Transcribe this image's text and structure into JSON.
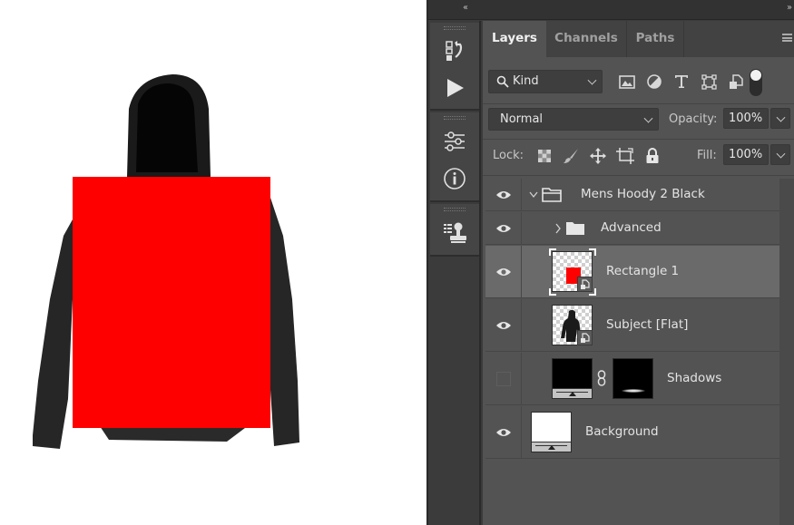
{
  "canvas": {
    "background_color": "#ffffff",
    "rectangle_color": "#ff0000",
    "garment_color": "#1e1e1e"
  },
  "window": {
    "collapse_left_glyph": "‹‹",
    "collapse_right_glyph": "››"
  },
  "dock": {
    "tools": [
      {
        "name": "history-icon"
      },
      {
        "name": "actions-play-icon"
      },
      {
        "name": "adjustments-icon"
      },
      {
        "name": "info-icon"
      },
      {
        "name": "clone-source-icon"
      }
    ]
  },
  "panel": {
    "tabs": [
      {
        "label": "Layers",
        "active": true
      },
      {
        "label": "Channels",
        "active": false
      },
      {
        "label": "Paths",
        "active": false
      }
    ],
    "filter": {
      "kind_label": "Kind",
      "filter_icons": [
        "image-filter-icon",
        "adjustment-filter-icon",
        "type-filter-icon",
        "shape-filter-icon",
        "smart-object-filter-icon"
      ]
    },
    "blend_mode": "Normal",
    "opacity_label": "Opacity:",
    "opacity_value": "100%",
    "lock_label": "Lock:",
    "fill_label": "Fill:",
    "fill_value": "100%",
    "layers": [
      {
        "name": "Mens Hoody 2 Black",
        "type": "group",
        "expanded": true,
        "visible": true,
        "selected": false
      },
      {
        "name": "Advanced",
        "type": "group",
        "expanded": false,
        "visible": true,
        "selected": false
      },
      {
        "name": "Rectangle 1",
        "type": "smart-object",
        "visible": true,
        "selected": true
      },
      {
        "name": "Subject [Flat]",
        "type": "smart-object",
        "visible": true,
        "selected": false
      },
      {
        "name": "Shadows",
        "type": "fill-with-mask",
        "visible": false,
        "selected": false
      },
      {
        "name": "Background",
        "type": "fill",
        "visible": true,
        "selected": false
      }
    ]
  },
  "colors": {
    "panel_bg": "#535353",
    "selected_row": "#6a6a6a",
    "text": "#e4e4e4"
  }
}
